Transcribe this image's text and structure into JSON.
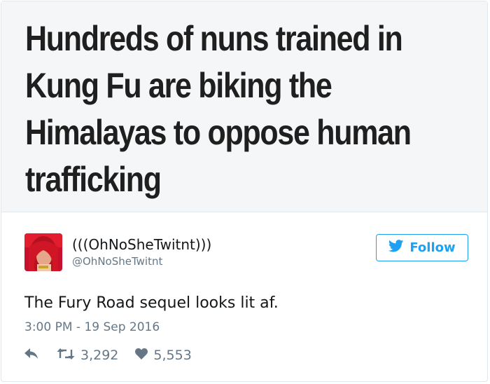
{
  "headline": "Hundreds of nuns trained in Kung Fu are biking the Himalayas to oppose human trafficking",
  "user": {
    "display_name": "(((OhNoSheTwitnt)))",
    "handle": "@OhNoSheTwitnt"
  },
  "follow_label": "Follow",
  "tweet": {
    "text": "The Fury Road sequel looks lit af.",
    "timestamp": "3:00 PM - 19 Sep 2016"
  },
  "stats": {
    "retweets": "3,292",
    "likes": "5,553"
  },
  "icons": {
    "follow": "twitter-bird-icon",
    "reply": "reply-icon",
    "retweet": "retweet-icon",
    "like": "heart-icon"
  },
  "colors": {
    "accent": "#1da1f2",
    "muted": "#657786",
    "text": "#14171a",
    "headline_bg": "#f5f6f7"
  }
}
